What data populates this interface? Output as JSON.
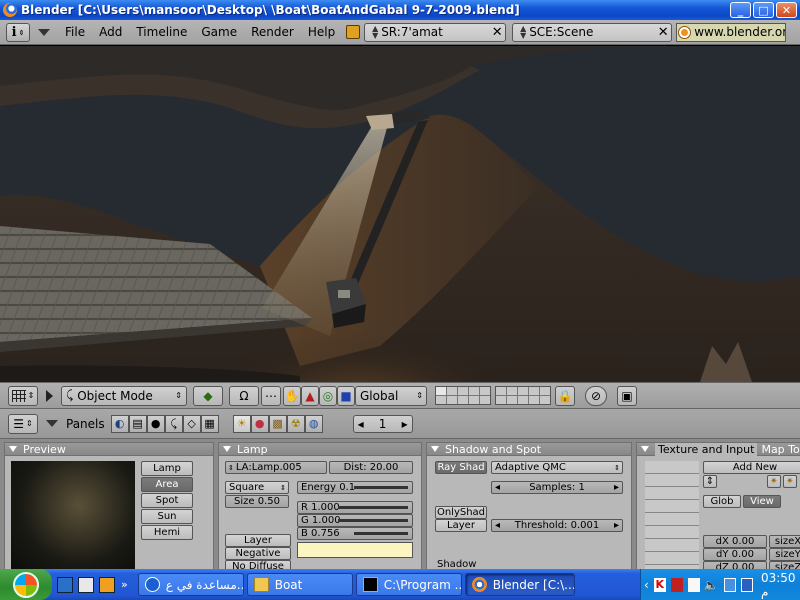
{
  "window": {
    "title": "Blender [C:\\Users\\mansoor\\Desktop\\  \\Boat\\BoatAndGabal 9-7-2009.blend]",
    "minimize": "_",
    "maximize": "□",
    "close": "✕"
  },
  "menubar": {
    "items": [
      "File",
      "Add",
      "Timeline",
      "Game",
      "Render",
      "Help"
    ],
    "screen_field": "SR:7'amat",
    "scene_field": "SCE:Scene",
    "url": "www.blender.org"
  },
  "view3d_header": {
    "mode": "Object Mode",
    "orientation": "Global"
  },
  "buttons_header": {
    "panels_label": "Panels",
    "frame": "1"
  },
  "preview_panel": {
    "title": "Preview",
    "types": [
      "Lamp",
      "Area",
      "Spot",
      "Sun",
      "Hemi"
    ],
    "selected_type": "Area"
  },
  "lamp_panel": {
    "title": "Lamp",
    "name_field": "LA:Lamp.005",
    "dist_field": "Dist: 20.00",
    "shape": "Square",
    "size": "Size 0.50",
    "energy": "Energy 0.1",
    "r": "R 1.000",
    "g": "G 1.000",
    "b": "B 0.756",
    "layer": "Layer",
    "negative": "Negative",
    "no_diffuse": "No Diffuse",
    "color_hex": "#fbf6c1"
  },
  "shadow_panel": {
    "title": "Shadow and Spot",
    "ray_shad": "Ray Shad",
    "sampling": "Adaptive QMC",
    "samples": "Samples: 1",
    "only_shad": "OnlyShad",
    "layer": "Layer",
    "threshold": "Threshold: 0.001",
    "shadow_label": "Shadow"
  },
  "texture_panel": {
    "tab_active": "Texture and Input",
    "tab_inactive": "Map To",
    "add_new": "Add New",
    "glob": "Glob",
    "view": "View",
    "dx": "dX 0.00",
    "dy": "dY 0.00",
    "dz": "dZ 0.00",
    "sizex": "sizeX",
    "sizey": "sizeY",
    "sizez": "sizeZ"
  },
  "taskbar": {
    "tasks": [
      "مساعدة في ع...",
      "Boat",
      "C:\\Program ...",
      "Blender [C:\\..."
    ],
    "clock": "03:50 م"
  },
  "colors": {
    "xp_blue": "#245edb",
    "blender_gray": "#b8b8b8",
    "lamp_color": "#fbf6c1"
  }
}
